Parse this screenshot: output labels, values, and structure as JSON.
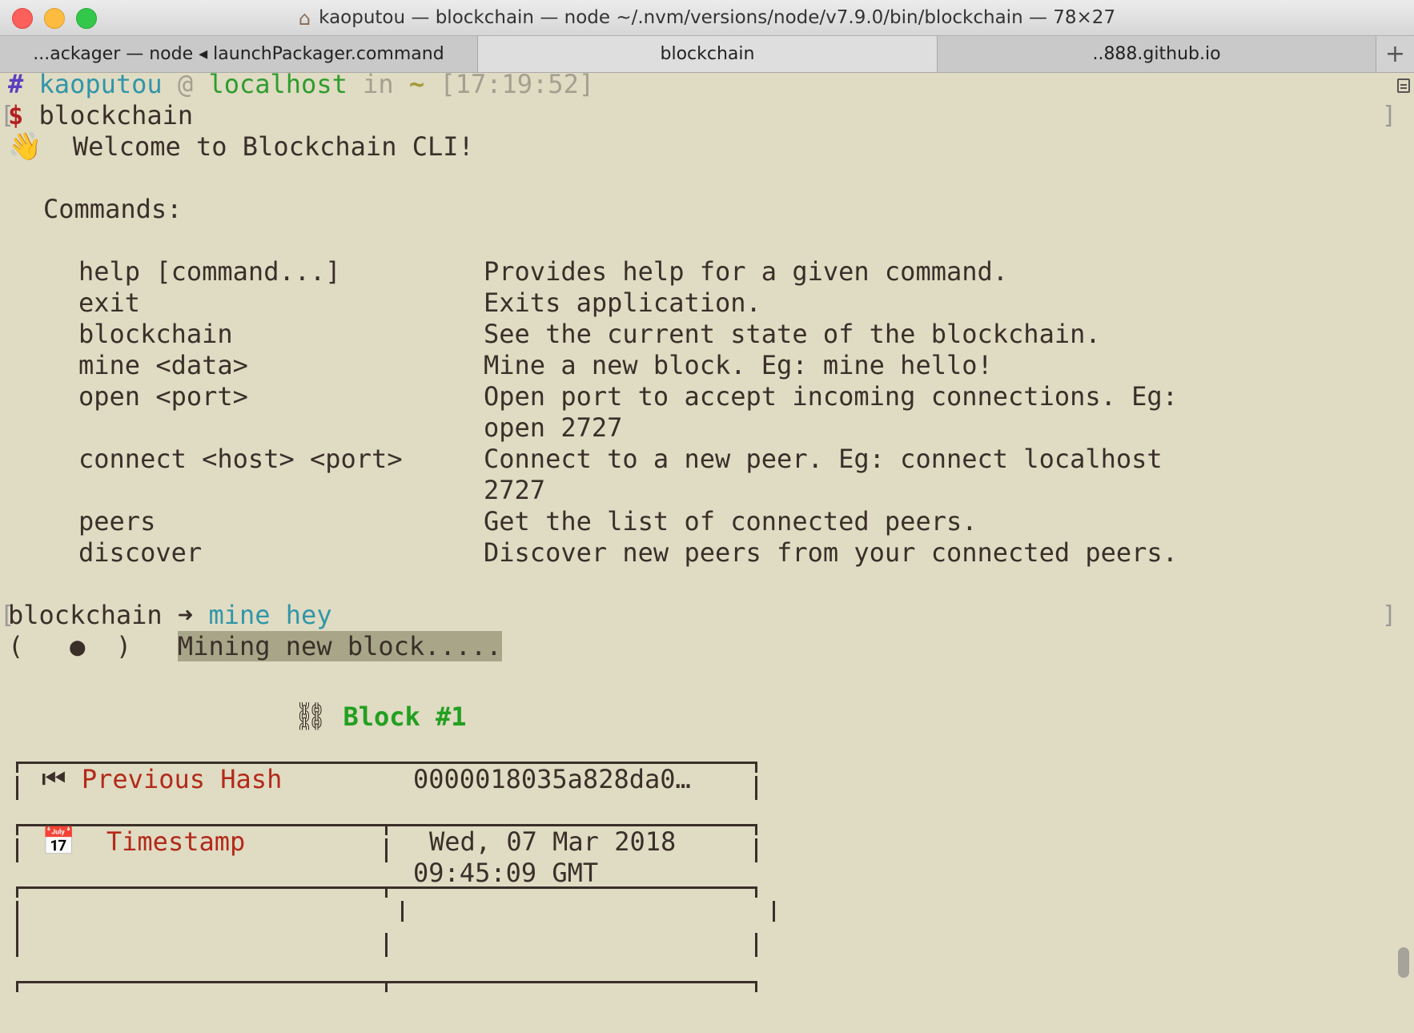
{
  "window": {
    "title": "kaoputou — blockchain — node ~/.nvm/versions/node/v7.9.0/bin/blockchain — 78×27",
    "home_icon": "home-icon"
  },
  "tabs": [
    {
      "label": "...ackager — node ◂ launchPackager.command"
    },
    {
      "label": "blockchain"
    },
    {
      "label": "..888.github.io"
    }
  ],
  "tab_add_label": "+",
  "prompt": {
    "hash": "#",
    "user": "kaoputou",
    "at": "@",
    "host": "localhost",
    "in": "in",
    "dir": "~",
    "time": "[17:19:52]",
    "dollar": "$",
    "command": "blockchain"
  },
  "welcome": {
    "emoji": "👋",
    "text": "Welcome to Blockchain CLI!"
  },
  "commands_header": "Commands:",
  "commands": [
    {
      "cmd": "help [command...]",
      "desc": "Provides help for a given command."
    },
    {
      "cmd": "exit",
      "desc": "Exits application."
    },
    {
      "cmd": "blockchain",
      "desc": "See the current state of the blockchain."
    },
    {
      "cmd": "mine <data>",
      "desc": "Mine a new block. Eg: mine hello!"
    },
    {
      "cmd": "open <port>",
      "desc": "Open port to accept incoming connections. Eg:",
      "desc2": "open 2727"
    },
    {
      "cmd": "connect <host> <port>",
      "desc": "Connect to a new peer. Eg: connect localhost",
      "desc2": "2727"
    },
    {
      "cmd": "peers",
      "desc": "Get the list of connected peers."
    },
    {
      "cmd": "discover",
      "desc": "Discover new peers from your connected peers."
    }
  ],
  "cli_prompt": {
    "name": "blockchain",
    "arrow": "➜",
    "input": "mine hey"
  },
  "spinner": {
    "frame": "(   ●  )",
    "message": "Mining new block....."
  },
  "block_table": {
    "chain_icon": "⛓",
    "title": "Block #1",
    "rows": [
      {
        "icon": "⏮",
        "label": "Previous Hash",
        "value": "0000018035a828da0…"
      },
      {
        "icon": "📅",
        "label": "Timestamp",
        "value": "Wed, 07 Mar 2018",
        "value2": "09:45:09 GMT"
      }
    ]
  },
  "colors": {
    "background": "#e0dbc3",
    "user": "#3196a8",
    "host": "#2e9c2e",
    "error_red": "#b22222",
    "block_title": "#22a020"
  }
}
